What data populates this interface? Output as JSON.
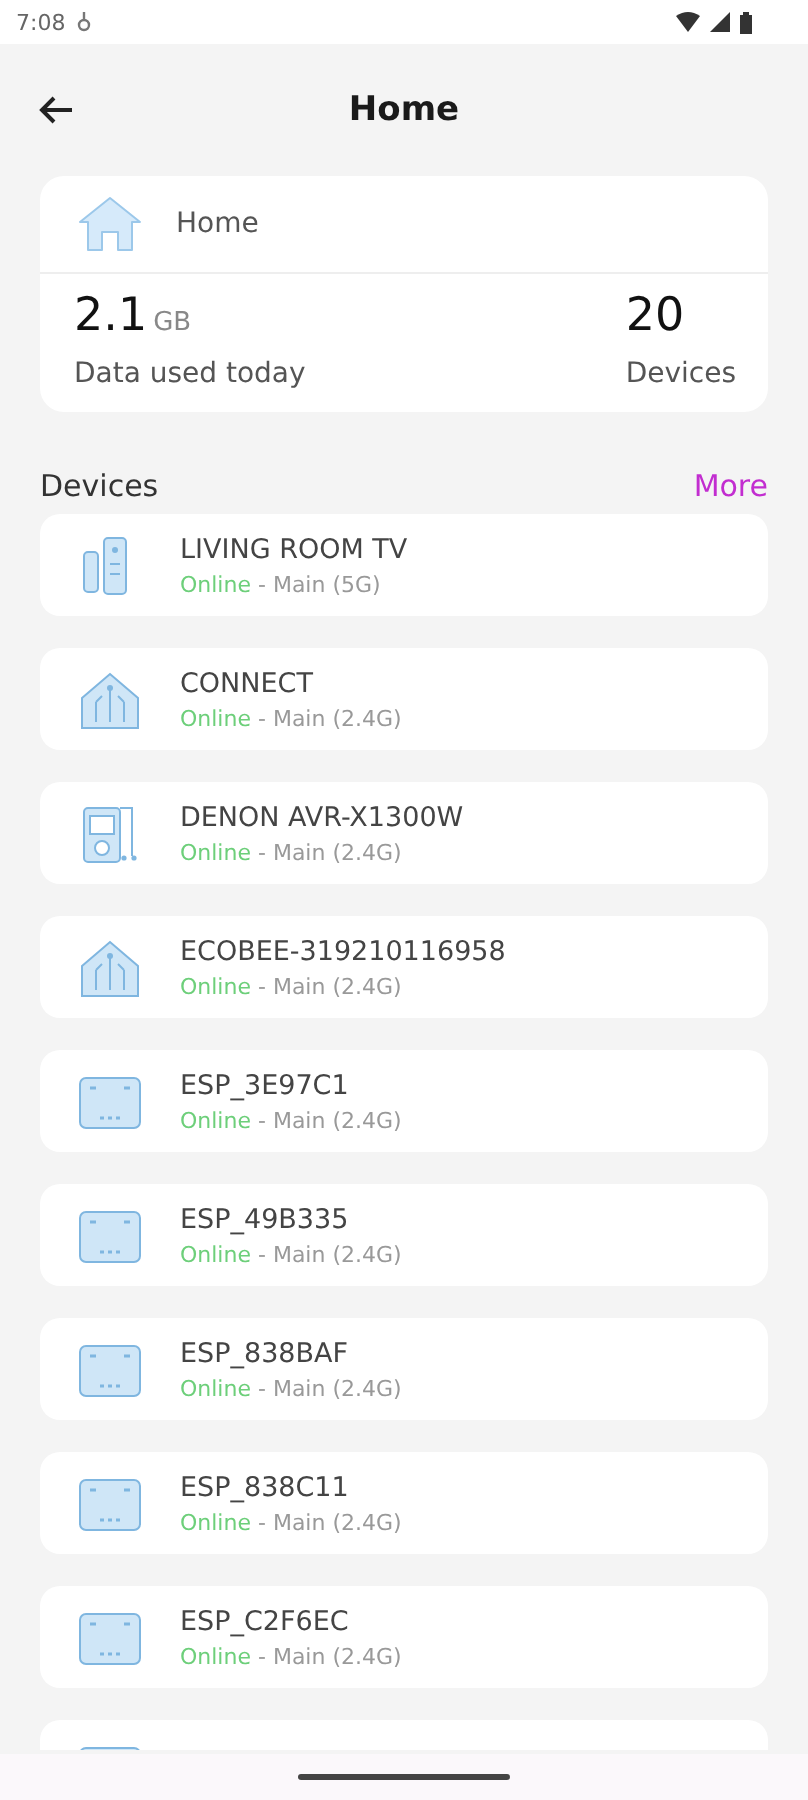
{
  "status_bar": {
    "time": "7:08"
  },
  "app_bar": {
    "title": "Home"
  },
  "summary": {
    "network_name": "Home",
    "data_value": "2.1",
    "data_unit": "GB",
    "data_label": "Data used today",
    "device_count": "20",
    "device_label": "Devices"
  },
  "devices_section": {
    "title": "Devices",
    "more": "More"
  },
  "devices": [
    {
      "kind": "stick",
      "name": "LIVING ROOM TV",
      "status": "Online",
      "network": " - Main (5G)"
    },
    {
      "kind": "hub",
      "name": "CONNECT",
      "status": "Online",
      "network": " - Main (2.4G)"
    },
    {
      "kind": "player",
      "name": "DENON AVR-X1300W",
      "status": "Online",
      "network": " - Main (2.4G)"
    },
    {
      "kind": "hub",
      "name": "ECOBEE-319210116958",
      "status": "Online",
      "network": " - Main (2.4G)"
    },
    {
      "kind": "module",
      "name": "ESP_3E97C1",
      "status": "Online",
      "network": " - Main (2.4G)"
    },
    {
      "kind": "module",
      "name": "ESP_49B335",
      "status": "Online",
      "network": " - Main (2.4G)"
    },
    {
      "kind": "module",
      "name": "ESP_838BAF",
      "status": "Online",
      "network": " - Main (2.4G)"
    },
    {
      "kind": "module",
      "name": "ESP_838C11",
      "status": "Online",
      "network": " - Main (2.4G)"
    },
    {
      "kind": "module",
      "name": "ESP_C2F6EC",
      "status": "Online",
      "network": " - Main (2.4G)"
    },
    {
      "kind": "module"
    }
  ]
}
